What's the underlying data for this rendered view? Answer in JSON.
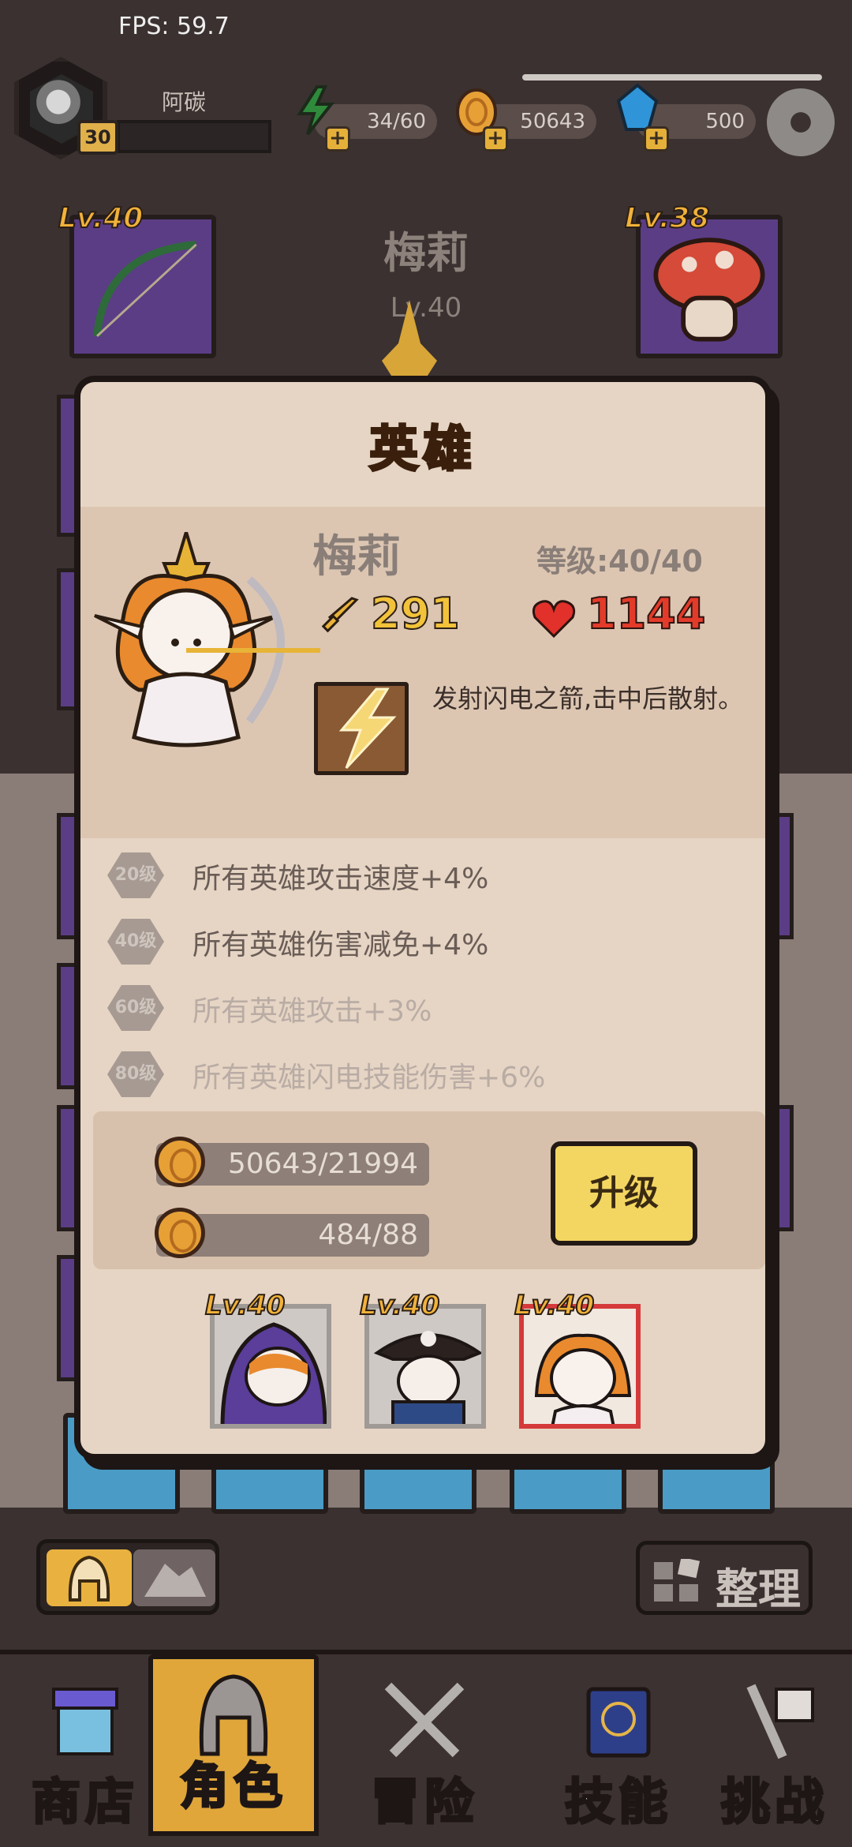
{
  "status": {
    "fps": "FPS: 59.7"
  },
  "player": {
    "name": "阿碳",
    "level": "30"
  },
  "resources": {
    "energy": "34/60",
    "gold": "50643",
    "gems": "500"
  },
  "background": {
    "hero_name": "梅莉",
    "hero_level": "Lv.40",
    "left_slot_level": "Lv.40",
    "right_slot_level": "Lv.38"
  },
  "modal": {
    "title": "英雄",
    "hero_name": "梅莉",
    "level_text": "等级:40/40",
    "attack": "291",
    "hp": "1144",
    "skill_desc": "发射闪电之箭,击中后散射。",
    "bonuses": [
      {
        "tier": "20级",
        "text": "所有英雄攻击速度+4%",
        "active": true
      },
      {
        "tier": "40级",
        "text": "所有英雄伤害减免+4%",
        "active": true
      },
      {
        "tier": "60级",
        "text": "所有英雄攻击+3%",
        "active": false
      },
      {
        "tier": "80级",
        "text": "所有英雄闪电技能伤害+6%",
        "active": false
      }
    ],
    "cost": {
      "gold": "50643/21994",
      "shards": "484/88"
    },
    "upgrade_label": "升级",
    "team": [
      {
        "level": "Lv.40",
        "selected": false
      },
      {
        "level": "Lv.40",
        "selected": false
      },
      {
        "level": "Lv.40",
        "selected": true
      }
    ]
  },
  "controls": {
    "sort_label": "整理"
  },
  "nav": [
    {
      "label": "商店",
      "active": false
    },
    {
      "label": "角色",
      "active": true
    },
    {
      "label": "冒险",
      "active": false
    },
    {
      "label": "技能",
      "active": false
    },
    {
      "label": "挑战",
      "active": false
    }
  ],
  "colors": {
    "accent": "#e0a63a",
    "attack": "#f2c23a",
    "hp": "#e33b2a",
    "upgrade": "#f3d661"
  }
}
